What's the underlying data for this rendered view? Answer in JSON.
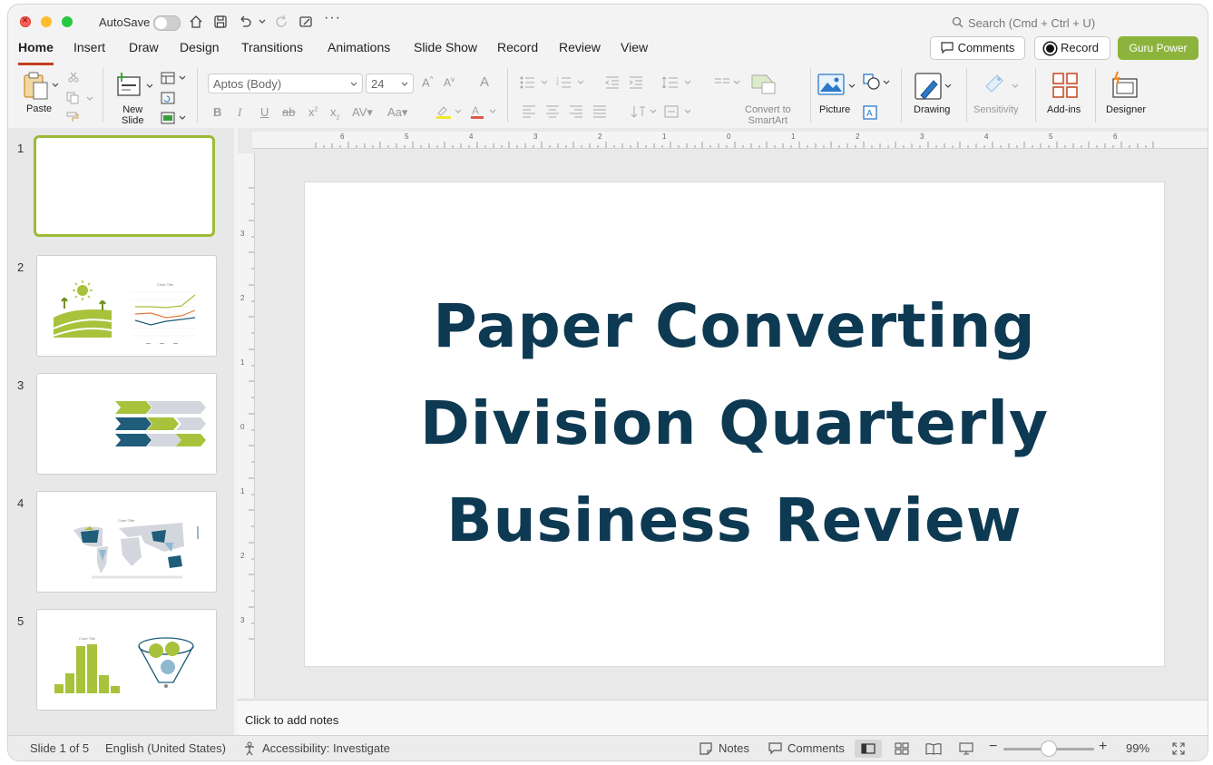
{
  "titlebar": {
    "autosave_label": "AutoSave",
    "search_placeholder": "Search (Cmd + Ctrl + U)"
  },
  "tabs": [
    {
      "label": "Home",
      "active": true
    },
    {
      "label": "Insert"
    },
    {
      "label": "Draw"
    },
    {
      "label": "Design"
    },
    {
      "label": "Transitions"
    },
    {
      "label": "Animations"
    },
    {
      "label": "Slide Show"
    },
    {
      "label": "Record"
    },
    {
      "label": "Review"
    },
    {
      "label": "View"
    }
  ],
  "header_buttons": {
    "comments": "Comments",
    "record": "Record",
    "guru": "Guru Power"
  },
  "ribbon": {
    "paste": "Paste",
    "new_slide_line1": "New",
    "new_slide_line2": "Slide",
    "font_name": "Aptos (Body)",
    "font_size": "24",
    "convert_line1": "Convert to",
    "convert_line2": "SmartArt",
    "picture": "Picture",
    "drawing": "Drawing",
    "sensitivity": "Sensitivity",
    "addins": "Add-ins",
    "designer": "Designer"
  },
  "thumbnails": [
    {
      "number": "1",
      "selected": true
    },
    {
      "number": "2"
    },
    {
      "number": "3"
    },
    {
      "number": "4"
    },
    {
      "number": "5"
    }
  ],
  "thumb2": {
    "chart_title": "Chart Title"
  },
  "thumb4": {
    "chart_title": "Chart Title"
  },
  "thumb5": {
    "chart_title": "Chart Title"
  },
  "ruler": {
    "h_labels": [
      "6",
      "5",
      "4",
      "3",
      "2",
      "1",
      "0",
      "1",
      "2",
      "3",
      "4",
      "5",
      "6"
    ],
    "v_labels": [
      "3",
      "2",
      "1",
      "0",
      "1",
      "2",
      "3"
    ]
  },
  "slide": {
    "title_line1": "Paper Converting",
    "title_line2": "Division Quarterly",
    "title_line3": "Business Review"
  },
  "notes": {
    "placeholder": "Click to add notes"
  },
  "statusbar": {
    "slide_info": "Slide 1 of 5",
    "language": "English (United States)",
    "accessibility": "Accessibility: Investigate",
    "notes": "Notes",
    "comments": "Comments",
    "zoom": "99%",
    "zoom_level": 0.5
  },
  "colors": {
    "accent_green": "#8cb43c",
    "title_navy": "#0d3a52",
    "tab_underline": "#c43e1c"
  }
}
